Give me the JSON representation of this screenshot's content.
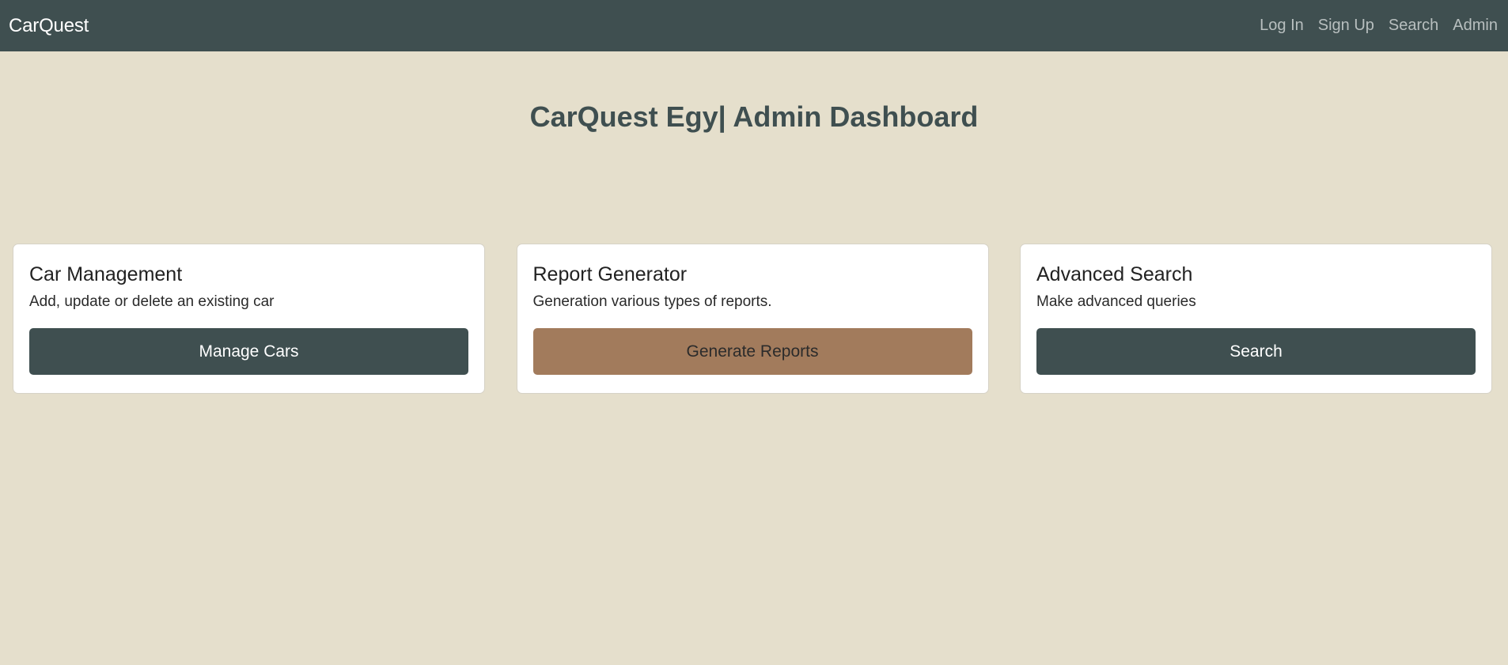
{
  "navbar": {
    "brand": "CarQuest",
    "links": [
      {
        "label": "Log In"
      },
      {
        "label": "Sign Up"
      },
      {
        "label": "Search"
      },
      {
        "label": "Admin"
      }
    ]
  },
  "main": {
    "title": "CarQuest Egy| Admin Dashboard",
    "cards": [
      {
        "title": "Car Management",
        "text": "Add, update or delete an existing car",
        "button": "Manage Cars",
        "button_color": "#3f4f50"
      },
      {
        "title": "Report Generator",
        "text": "Generation various types of reports.",
        "button": "Generate Reports",
        "button_color": "#a27b5c"
      },
      {
        "title": "Advanced Search",
        "text": "Make advanced queries",
        "button": "Search",
        "button_color": "#3f4f50"
      }
    ]
  },
  "colors": {
    "navbar_bg": "#3f4f50",
    "page_bg": "#e5dfcc",
    "accent": "#a27b5c"
  }
}
